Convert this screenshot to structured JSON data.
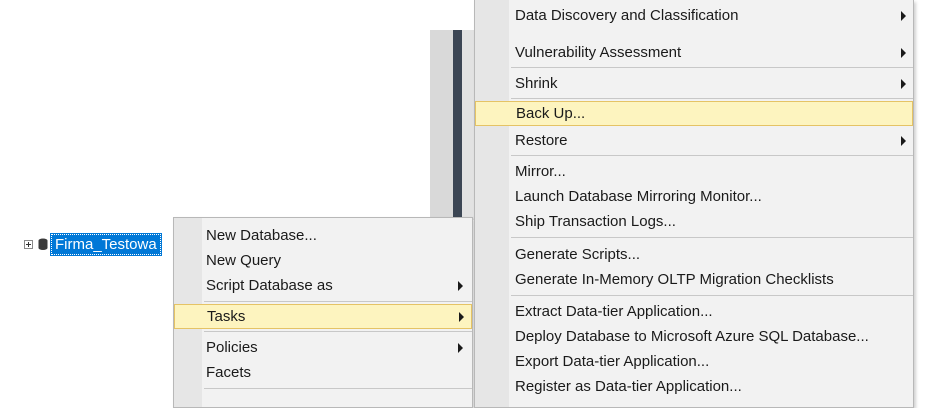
{
  "tree": {
    "node_label": "Firma_Testowa"
  },
  "context_menu": {
    "items": [
      {
        "label": "New Database..."
      },
      {
        "label": "New Query"
      },
      {
        "label": "Script Database as"
      },
      {
        "label": "Tasks"
      },
      {
        "label": "Policies"
      },
      {
        "label": "Facets"
      }
    ]
  },
  "tasks_menu": {
    "items": [
      {
        "label": "Data Discovery and Classification"
      },
      {
        "label": "Vulnerability Assessment"
      },
      {
        "label": "Shrink"
      },
      {
        "label": "Back Up..."
      },
      {
        "label": "Restore"
      },
      {
        "label": "Mirror..."
      },
      {
        "label": "Launch Database Mirroring Monitor..."
      },
      {
        "label": "Ship Transaction Logs..."
      },
      {
        "label": "Generate Scripts..."
      },
      {
        "label": "Generate In-Memory OLTP Migration Checklists"
      },
      {
        "label": "Extract Data-tier Application..."
      },
      {
        "label": "Deploy Database to Microsoft Azure SQL Database..."
      },
      {
        "label": "Export Data-tier Application..."
      },
      {
        "label": "Register as Data-tier Application..."
      }
    ]
  },
  "icons": {
    "expander": "plus-box-icon",
    "database": "database-icon",
    "submenu": "submenu-arrow-icon"
  },
  "colors": {
    "selection": "#0078d7",
    "highlight_bg": "#fdf4bf",
    "highlight_border": "#e5c365",
    "menu_bg": "#f2f2f2"
  }
}
